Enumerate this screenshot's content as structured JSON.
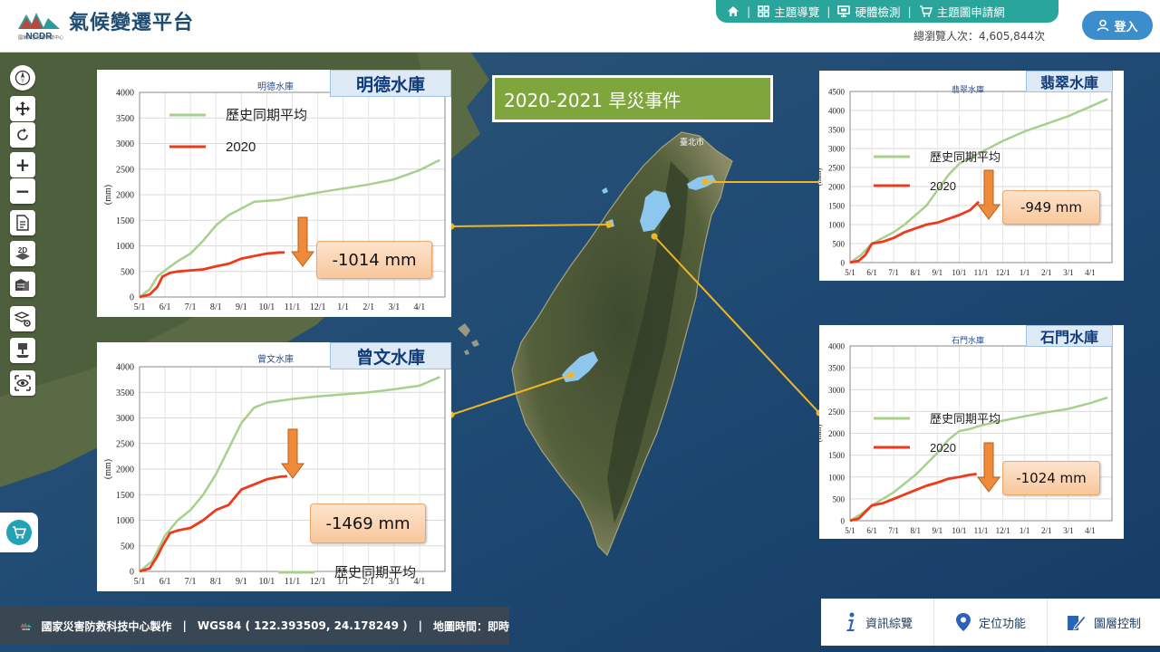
{
  "header": {
    "app_title": "氣候變遷平台",
    "logo_text": "NCDR",
    "logo_sub": "國家災害防救科技中心",
    "nav": [
      {
        "label": "",
        "icon": "home-icon"
      },
      {
        "label": "主題導覽",
        "icon": "grid-icon"
      },
      {
        "label": "硬體檢測",
        "icon": "monitor-icon"
      },
      {
        "label": "主題圖申請網",
        "icon": "cart-icon"
      }
    ],
    "views": "總瀏覽人次：4,605,844次",
    "login": "登入"
  },
  "toolbar": {
    "compass": "compass-icon",
    "pan": "move-icon",
    "rotate": "rotate-icon",
    "zoom_in": "+",
    "zoom_out": "−",
    "tool_2d": "2D"
  },
  "event_title": "2020-2021 旱災事件",
  "charts_text": {
    "legend_hist": "歷史同期平均",
    "legend_2020": "2020",
    "ylabel": "(mm)"
  },
  "reservoirs": [
    {
      "name": "明德水庫",
      "small": "明德水庫",
      "diff": "-1014 mm"
    },
    {
      "name": "曾文水庫",
      "small": "曾文水庫",
      "diff": "-1469 mm"
    },
    {
      "name": "翡翠水庫",
      "small": "翡翠水庫",
      "diff": "-949 mm"
    },
    {
      "name": "石門水庫",
      "small": "石門水庫",
      "diff": "-1024 mm"
    }
  ],
  "map_label_taipei": "臺北市",
  "chart_data": [
    {
      "type": "line",
      "title": "明德水庫",
      "x": [
        "5/1",
        "6/1",
        "7/1",
        "8/1",
        "9/1",
        "10/1",
        "11/1",
        "12/1",
        "1/1",
        "2/1",
        "3/1",
        "4/1"
      ],
      "ylabel": "(mm)",
      "ylim": [
        0,
        4000
      ],
      "yticks": [
        0,
        500,
        1000,
        1500,
        2000,
        2500,
        3000,
        3500,
        4000
      ],
      "series": [
        {
          "name": "歷史同期平均",
          "color": "#a8d08d",
          "points": [
            [
              0,
              0
            ],
            [
              0.4,
              150
            ],
            [
              0.7,
              400
            ],
            [
              1,
              520
            ],
            [
              1.5,
              700
            ],
            [
              2,
              850
            ],
            [
              2.5,
              1100
            ],
            [
              3,
              1400
            ],
            [
              3.5,
              1600
            ],
            [
              4,
              1730
            ],
            [
              4.5,
              1860
            ],
            [
              5,
              1880
            ],
            [
              5.5,
              1900
            ],
            [
              6,
              1950
            ],
            [
              7,
              2040
            ],
            [
              8,
              2120
            ],
            [
              9,
              2200
            ],
            [
              10,
              2300
            ],
            [
              11,
              2480
            ],
            [
              11.8,
              2680
            ]
          ]
        },
        {
          "name": "2020",
          "color": "#ee3a1b",
          "points": [
            [
              0,
              0
            ],
            [
              0.4,
              50
            ],
            [
              0.7,
              200
            ],
            [
              0.9,
              400
            ],
            [
              1.2,
              470
            ],
            [
              1.5,
              500
            ],
            [
              2,
              520
            ],
            [
              2.5,
              540
            ],
            [
              3,
              600
            ],
            [
              3.5,
              650
            ],
            [
              4,
              750
            ],
            [
              4.5,
              800
            ],
            [
              5,
              850
            ],
            [
              5.5,
              870
            ],
            [
              5.7,
              870
            ]
          ]
        }
      ]
    },
    {
      "type": "line",
      "title": "曾文水庫",
      "x": [
        "5/1",
        "6/1",
        "7/1",
        "8/1",
        "9/1",
        "10/1",
        "11/1",
        "12/1",
        "1/1",
        "2/1",
        "3/1",
        "4/1"
      ],
      "ylabel": "(mm)",
      "ylim": [
        0,
        4000
      ],
      "yticks": [
        0,
        500,
        1000,
        1500,
        2000,
        2500,
        3000,
        3500,
        4000
      ],
      "series": [
        {
          "name": "歷史同期平均",
          "color": "#a8d08d",
          "points": [
            [
              0,
              0
            ],
            [
              0.5,
              200
            ],
            [
              0.8,
              500
            ],
            [
              1,
              700
            ],
            [
              1.5,
              1000
            ],
            [
              2,
              1200
            ],
            [
              2.5,
              1500
            ],
            [
              3,
              1900
            ],
            [
              3.5,
              2400
            ],
            [
              4,
              2900
            ],
            [
              4.5,
              3200
            ],
            [
              5,
              3300
            ],
            [
              6,
              3370
            ],
            [
              7,
              3420
            ],
            [
              8,
              3460
            ],
            [
              9,
              3500
            ],
            [
              10,
              3560
            ],
            [
              11,
              3630
            ],
            [
              11.8,
              3800
            ]
          ]
        },
        {
          "name": "2020",
          "color": "#ee3a1b",
          "points": [
            [
              0,
              0
            ],
            [
              0.4,
              60
            ],
            [
              0.7,
              300
            ],
            [
              0.9,
              500
            ],
            [
              1.2,
              750
            ],
            [
              1.5,
              800
            ],
            [
              2,
              850
            ],
            [
              2.5,
              1000
            ],
            [
              3,
              1200
            ],
            [
              3.5,
              1300
            ],
            [
              4,
              1600
            ],
            [
              4.5,
              1700
            ],
            [
              5,
              1800
            ],
            [
              5.5,
              1850
            ],
            [
              5.8,
              1860
            ]
          ]
        }
      ]
    },
    {
      "type": "line",
      "title": "翡翠水庫",
      "x": [
        "5/1",
        "6/1",
        "7/1",
        "8/1",
        "9/1",
        "10/1",
        "11/1",
        "12/1",
        "1/1",
        "2/1",
        "3/1",
        "4/1"
      ],
      "ylabel": "(mm)",
      "ylim": [
        0,
        4500
      ],
      "yticks": [
        0,
        500,
        1000,
        1500,
        2000,
        2500,
        3000,
        3500,
        4000,
        4500
      ],
      "series": [
        {
          "name": "歷史同期平均",
          "color": "#a8d08d",
          "points": [
            [
              0,
              0
            ],
            [
              0.5,
              200
            ],
            [
              1,
              500
            ],
            [
              1.5,
              650
            ],
            [
              2,
              800
            ],
            [
              2.5,
              1000
            ],
            [
              3,
              1250
            ],
            [
              3.5,
              1500
            ],
            [
              4,
              1900
            ],
            [
              4.5,
              2300
            ],
            [
              5,
              2600
            ],
            [
              5.5,
              2750
            ],
            [
              6,
              2900
            ],
            [
              7,
              3200
            ],
            [
              8,
              3450
            ],
            [
              9,
              3650
            ],
            [
              10,
              3850
            ],
            [
              11,
              4100
            ],
            [
              11.8,
              4300
            ]
          ]
        },
        {
          "name": "2020",
          "color": "#ee3a1b",
          "points": [
            [
              0,
              0
            ],
            [
              0.4,
              50
            ],
            [
              0.7,
              200
            ],
            [
              1,
              500
            ],
            [
              1.5,
              550
            ],
            [
              2,
              650
            ],
            [
              2.5,
              800
            ],
            [
              3,
              900
            ],
            [
              3.5,
              1000
            ],
            [
              4,
              1050
            ],
            [
              4.5,
              1150
            ],
            [
              5,
              1250
            ],
            [
              5.5,
              1380
            ],
            [
              5.9,
              1600
            ]
          ]
        }
      ]
    },
    {
      "type": "line",
      "title": "石門水庫",
      "x": [
        "5/1",
        "6/1",
        "7/1",
        "8/1",
        "9/1",
        "10/1",
        "11/1",
        "12/1",
        "1/1",
        "2/1",
        "3/1",
        "4/1"
      ],
      "ylabel": "(mm)",
      "ylim": [
        0,
        4000
      ],
      "yticks": [
        0,
        500,
        1000,
        1500,
        2000,
        2500,
        3000,
        3500,
        4000
      ],
      "series": [
        {
          "name": "歷史同期平均",
          "color": "#a8d08d",
          "points": [
            [
              0,
              0
            ],
            [
              0.5,
              150
            ],
            [
              1,
              350
            ],
            [
              1.5,
              500
            ],
            [
              2,
              650
            ],
            [
              2.5,
              850
            ],
            [
              3,
              1050
            ],
            [
              3.5,
              1300
            ],
            [
              4,
              1550
            ],
            [
              4.5,
              1850
            ],
            [
              5,
              2050
            ],
            [
              5.5,
              2100
            ],
            [
              6,
              2180
            ],
            [
              7,
              2290
            ],
            [
              8,
              2390
            ],
            [
              9,
              2480
            ],
            [
              10,
              2560
            ],
            [
              11,
              2690
            ],
            [
              11.8,
              2820
            ]
          ]
        },
        {
          "name": "2020",
          "color": "#ee3a1b",
          "points": [
            [
              0,
              0
            ],
            [
              0.4,
              50
            ],
            [
              0.7,
              200
            ],
            [
              1,
              350
            ],
            [
              1.5,
              400
            ],
            [
              2,
              500
            ],
            [
              2.5,
              600
            ],
            [
              3,
              700
            ],
            [
              3.5,
              800
            ],
            [
              4,
              870
            ],
            [
              4.5,
              960
            ],
            [
              5,
              1000
            ],
            [
              5.5,
              1050
            ],
            [
              5.8,
              1070
            ]
          ]
        }
      ]
    }
  ],
  "footer": {
    "org": "國家災害防救科技中心製作",
    "coords": "WGS84 ( 122.393509, 24.178249 )",
    "time": "地圖時間：即時"
  },
  "bottom_bar": [
    {
      "label": "資訊綜覽",
      "icon": "info-icon"
    },
    {
      "label": "定位功能",
      "icon": "location-pin-icon"
    },
    {
      "label": "圖層控制",
      "icon": "layer-edit-icon"
    }
  ]
}
